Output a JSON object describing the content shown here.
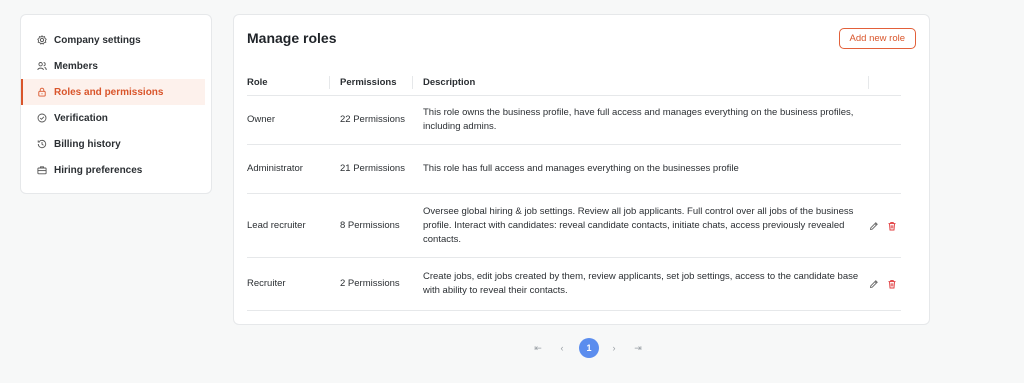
{
  "sidebar": {
    "items": [
      {
        "label": "Company settings",
        "icon": "gear-icon",
        "active": false
      },
      {
        "label": "Members",
        "icon": "users-icon",
        "active": false
      },
      {
        "label": "Roles and permissions",
        "icon": "lock-icon",
        "active": true
      },
      {
        "label": "Verification",
        "icon": "check-circle-icon",
        "active": false
      },
      {
        "label": "Billing history",
        "icon": "clock-icon",
        "active": false
      },
      {
        "label": "Hiring preferences",
        "icon": "briefcase-icon",
        "active": false
      }
    ]
  },
  "main": {
    "title": "Manage roles",
    "add_button": "Add new role",
    "columns": [
      "Role",
      "Permissions",
      "Description"
    ],
    "rows": [
      {
        "role": "Owner",
        "permissions": "22 Permissions",
        "description": "This role owns the business profile, have full access and manages everything on the business profiles, including admins.",
        "editable": false
      },
      {
        "role": "Administrator",
        "permissions": "21 Permissions",
        "description": "This role has full access and manages everything on the businesses profile",
        "editable": false
      },
      {
        "role": "Lead recruiter",
        "permissions": "8 Permissions",
        "description": "Oversee global hiring & job settings. Review all job applicants. Full control over all jobs of the business profile. Interact with candidates: reveal candidate contacts, initiate chats, access previously revealed contacts.",
        "editable": true
      },
      {
        "role": "Recruiter",
        "permissions": "2 Permissions",
        "description": "Create jobs, edit jobs created by them, review applicants, set job settings, access to the candidate base with ability to reveal their contacts.",
        "editable": true
      }
    ]
  },
  "pagination": {
    "first": "⇤",
    "prev": "‹",
    "current": "1",
    "next": "›",
    "last": "⇥"
  },
  "colors": {
    "accent": "#d9552b",
    "page_current": "#5b8dee"
  }
}
